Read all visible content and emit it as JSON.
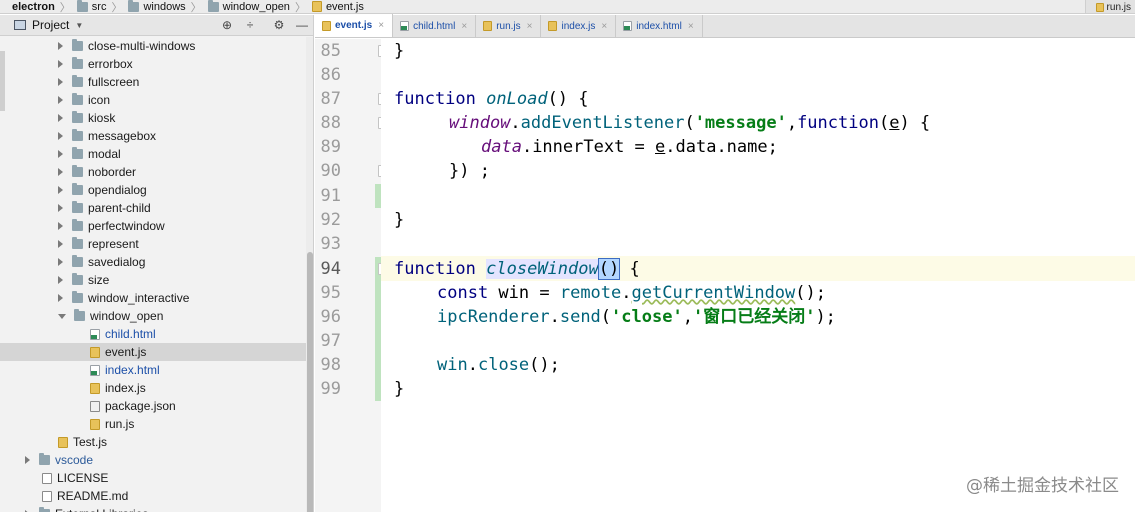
{
  "breadcrumb": {
    "items": [
      "electron",
      "src",
      "windows",
      "window_open",
      "event.js"
    ],
    "separator": "〉"
  },
  "run_config": {
    "label": "run.js"
  },
  "project_panel": {
    "title": "Project",
    "tools": [
      "⊕",
      "÷",
      "⚙",
      "—"
    ],
    "tree": [
      {
        "label": "close-multi-windows",
        "type": "folder"
      },
      {
        "label": "errorbox",
        "type": "folder"
      },
      {
        "label": "fullscreen",
        "type": "folder"
      },
      {
        "label": "icon",
        "type": "folder"
      },
      {
        "label": "kiosk",
        "type": "folder"
      },
      {
        "label": "messagebox",
        "type": "folder"
      },
      {
        "label": "modal",
        "type": "folder"
      },
      {
        "label": "noborder",
        "type": "folder"
      },
      {
        "label": "opendialog",
        "type": "folder"
      },
      {
        "label": "parent-child",
        "type": "folder"
      },
      {
        "label": "perfectwindow",
        "type": "folder"
      },
      {
        "label": "represent",
        "type": "folder"
      },
      {
        "label": "savedialog",
        "type": "folder"
      },
      {
        "label": "size",
        "type": "folder"
      },
      {
        "label": "window_interactive",
        "type": "folder"
      },
      {
        "label": "window_open",
        "type": "folder-open"
      },
      {
        "label": "child.html",
        "type": "html"
      },
      {
        "label": "event.js",
        "type": "js",
        "selected": true
      },
      {
        "label": "index.html",
        "type": "html"
      },
      {
        "label": "index.js",
        "type": "js"
      },
      {
        "label": "package.json",
        "type": "pkg"
      },
      {
        "label": "run.js",
        "type": "js"
      },
      {
        "label": "Test.js",
        "type": "js"
      },
      {
        "label": "vscode",
        "type": "folder"
      },
      {
        "label": "LICENSE",
        "type": "txt"
      },
      {
        "label": "README.md",
        "type": "txt"
      },
      {
        "label": "External Libraries",
        "type": "folder"
      }
    ]
  },
  "editor": {
    "tabs": [
      {
        "label": "event.js",
        "icon": "js",
        "active": true
      },
      {
        "label": "child.html",
        "icon": "html"
      },
      {
        "label": "run.js",
        "icon": "js"
      },
      {
        "label": "index.js",
        "icon": "js"
      },
      {
        "label": "index.html",
        "icon": "html"
      }
    ],
    "tab_close": "×",
    "line_numbers": [
      "85",
      "86",
      "87",
      "88",
      "89",
      "90",
      "91",
      "92",
      "93",
      "94",
      "95",
      "96",
      "97",
      "98",
      "99"
    ],
    "current_line": "94",
    "code": {
      "l85_brace": "}",
      "l87_kw": "function",
      "l87_name": "onLoad",
      "l87_rest": "() {",
      "l88_obj": "window",
      "l88_dot": ".",
      "l88_meth": "addEventListener",
      "l88_p1": "(",
      "l88_str": "'message'",
      "l88_comma": ",",
      "l88_kw": "function",
      "l88_p2": "(",
      "l88_param": "e",
      "l88_end": ") {",
      "l89_data": "data",
      "l89_mid": ".innerText = ",
      "l89_e": "e",
      "l89_end": ".data.name;",
      "l90": "}) ;",
      "l92": "}",
      "l94_kw": "function",
      "l94_name": "closeWindow",
      "l94_paren": "()",
      "l94_rest": " {",
      "l95_kw": "const",
      "l95_var": " win = ",
      "l95_remote": "remote",
      "l95_dot": ".",
      "l95_meth": "getCurrentWindow",
      "l95_end": "();",
      "l96_obj": "ipcRenderer",
      "l96_dot": ".",
      "l96_meth": "send",
      "l96_p": "(",
      "l96_str1": "'close'",
      "l96_comma": ",",
      "l96_str2": "'窗口已经关闭'",
      "l96_end": ");",
      "l98_obj": "win",
      "l98_dot": ".",
      "l98_meth": "close",
      "l98_end": "();",
      "l99": "}"
    }
  },
  "watermark": "@稀土掘金技术社区"
}
